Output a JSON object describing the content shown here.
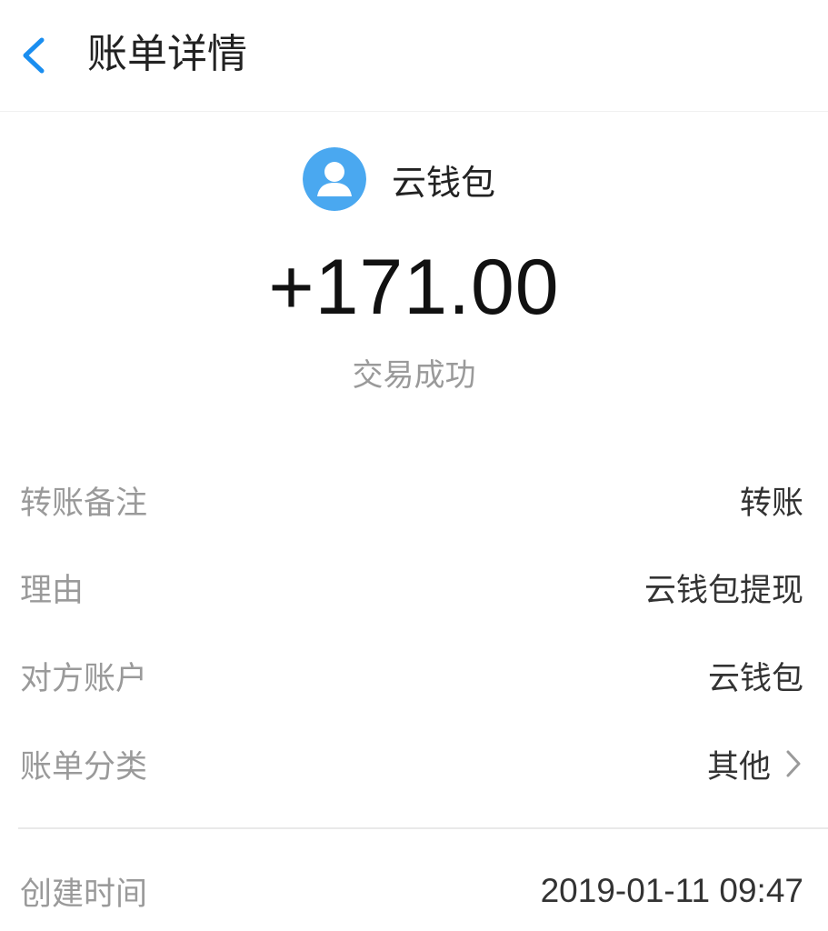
{
  "header": {
    "title": "账单详情",
    "back_icon": "chevron-left-icon",
    "accent_color": "#1a8ef0"
  },
  "payee": {
    "name": "云钱包",
    "avatar_icon": "user-avatar-icon",
    "avatar_color": "#4aa8f0"
  },
  "transaction": {
    "amount": "+171.00",
    "status": "交易成功"
  },
  "details": {
    "remark": {
      "label": "转账备注",
      "value": "转账"
    },
    "reason": {
      "label": "理由",
      "value": "云钱包提现"
    },
    "counterparty": {
      "label": "对方账户",
      "value": "云钱包"
    },
    "category": {
      "label": "账单分类",
      "value": "其他",
      "icon": "chevron-right-icon"
    },
    "created_time": {
      "label": "创建时间",
      "value": "2019-01-11 09:47"
    }
  }
}
